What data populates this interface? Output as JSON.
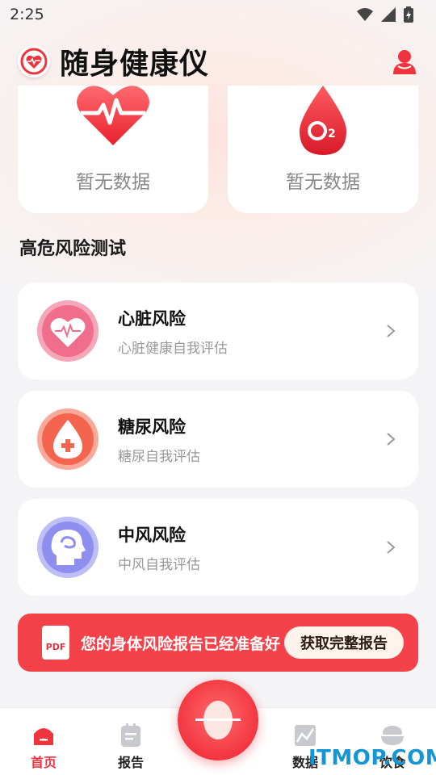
{
  "status_bar": {
    "time": "2:25"
  },
  "header": {
    "title": "随身健康仪"
  },
  "metrics": [
    {
      "value": "暂无数据",
      "icon": "heart-rate-icon"
    },
    {
      "value": "暂无数据",
      "icon": "blood-oxygen-icon"
    }
  ],
  "section": {
    "title": "高危风险测试"
  },
  "risks": [
    {
      "name": "心脏风险",
      "desc": "心脏健康自我评估",
      "icon": "heart-risk-icon",
      "color": "#f0577c"
    },
    {
      "name": "糖尿风险",
      "desc": "糖尿自我评估",
      "icon": "diabetes-risk-icon",
      "color": "#f56752"
    },
    {
      "name": "中风风险",
      "desc": "中风自我评估",
      "icon": "stroke-risk-icon",
      "color": "#8f8ff0"
    }
  ],
  "banner": {
    "pdf_label": "PDF",
    "text": "您的身体风险报告已经准备好",
    "button": "获取完整报告"
  },
  "tabs": [
    {
      "label": "首页",
      "active": true
    },
    {
      "label": "报告",
      "active": false
    },
    {
      "label": "数据",
      "active": false
    },
    {
      "label": "饮食",
      "active": false
    }
  ],
  "watermark": "ITMOP.COM",
  "colors": {
    "accent": "#f0333d",
    "banner": "#f5424a"
  }
}
